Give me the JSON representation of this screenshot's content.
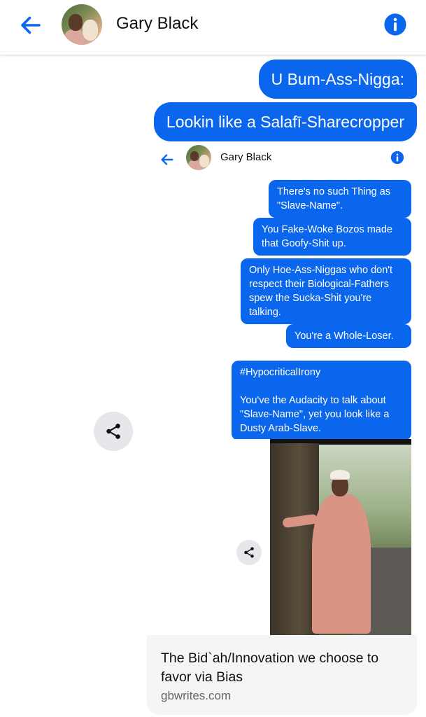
{
  "header": {
    "contact_name": "Gary Black"
  },
  "messages": [
    {
      "text": "U Bum-Ass-Nigga:"
    },
    {
      "text": "Lookin like a Salafī-Sharecropper"
    }
  ],
  "shared": {
    "header": {
      "contact_name": "Gary Black"
    },
    "messages": [
      {
        "text": "There's no such Thing as\n\"Slave-Name\"."
      },
      {
        "text": "You Fake-Woke Bozos made\nthat Goofy-Shit up."
      },
      {
        "text": "Only Hoe-Ass-Niggas who don't\nrespect their Biological-Fathers\nspew the Sucka-Shit you're\ntalking."
      },
      {
        "text": "You're a Whole-Loser."
      },
      {
        "text": "#HypocriticalIrony\n\nYou've the Audacity to talk about\n\"Slave-Name\", yet you look like a\nDusty Arab-Slave."
      }
    ]
  },
  "link_preview": {
    "title": "The Bid`ah/Innovation we choose to favor via Bias",
    "domain": "gbwrites.com"
  },
  "colors": {
    "accent": "#0a66ec",
    "bubble_text": "#ffffff"
  },
  "icons": [
    "back-arrow-icon",
    "info-icon",
    "share-icon"
  ]
}
